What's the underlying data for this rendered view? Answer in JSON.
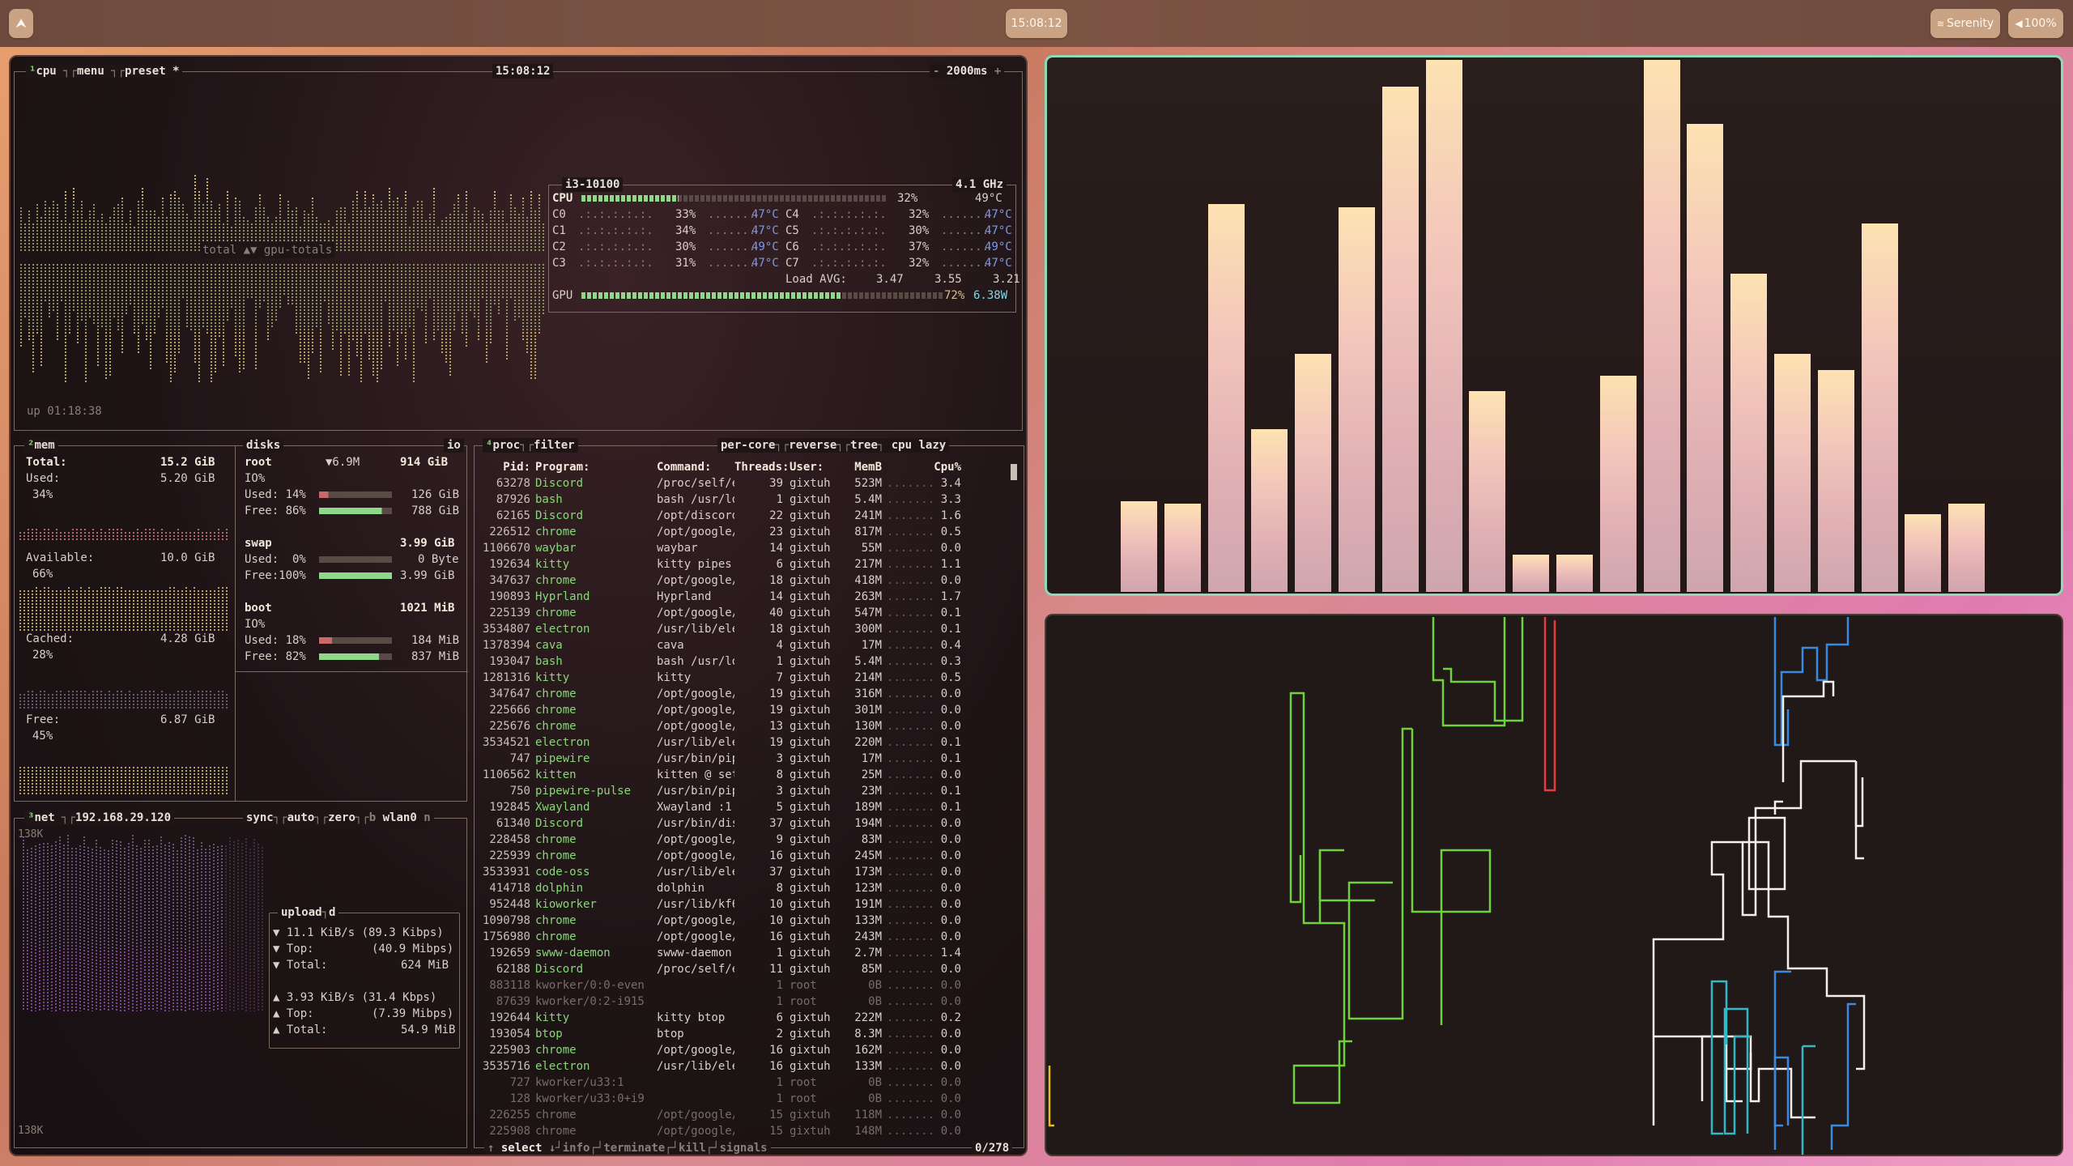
{
  "topbar": {
    "launcher_icon": "arch-icon",
    "clock": "15:08:12",
    "wifi": "Serenity",
    "volume": "100%"
  },
  "btop": {
    "cpu_box": {
      "title_cpu": "cpu",
      "title_menu": "menu",
      "title_preset": "preset *",
      "time": "15:08:12",
      "interval": "2000ms",
      "graph_label": "total ▲▼ gpu-totals",
      "uptime": "up 01:18:38"
    },
    "cpu_info": {
      "model": "i3-10100",
      "freq": "4.1 GHz",
      "total_label": "CPU",
      "total_pct": "32%",
      "total_temp": "49°C",
      "cores": [
        {
          "name": "C0",
          "pct": "33%",
          "temp": "47°C"
        },
        {
          "name": "C1",
          "pct": "34%",
          "temp": "47°C"
        },
        {
          "name": "C2",
          "pct": "30%",
          "temp": "49°C"
        },
        {
          "name": "C3",
          "pct": "31%",
          "temp": "47°C"
        },
        {
          "name": "C4",
          "pct": "32%",
          "temp": "47°C"
        },
        {
          "name": "C5",
          "pct": "30%",
          "temp": "47°C"
        },
        {
          "name": "C6",
          "pct": "37%",
          "temp": "49°C"
        },
        {
          "name": "C7",
          "pct": "32%",
          "temp": "47°C"
        }
      ],
      "load_label": "Load AVG:",
      "load": [
        "3.47",
        "3.55",
        "3.21"
      ],
      "gpu_label": "GPU",
      "gpu_pct": "72%",
      "gpu_power": "6.38W"
    },
    "mem": {
      "title": "mem",
      "total_label": "Total:",
      "total": "15.2 GiB",
      "used_label": "Used:",
      "used": "5.20 GiB",
      "used_pct": "34%",
      "avail_label": "Available:",
      "avail": "10.0 GiB",
      "avail_pct": "66%",
      "cached_label": "Cached:",
      "cached": "4.28 GiB",
      "cached_pct": "28%",
      "free_label": "Free:",
      "free": "6.87 GiB",
      "free_pct": "45%"
    },
    "disks": {
      "title": "disks",
      "io_label": "io",
      "root": {
        "name": "root",
        "io_rate": "▼6.9M",
        "size": "914 GiB",
        "io": "IO%",
        "used_label": "Used: 14%",
        "used": "126 GiB",
        "free_label": "Free: 86%",
        "free": "788 GiB"
      },
      "swap": {
        "name": "swap",
        "size": "3.99 GiB",
        "used_label": "Used:  0%",
        "used": "0 Byte",
        "free_label": "Free:100%",
        "free": "3.99 GiB"
      },
      "boot": {
        "name": "boot",
        "size": "1021 MiB",
        "io": "IO%",
        "used_label": "Used: 18%",
        "used": "184 MiB",
        "free_label": "Free: 82%",
        "free": "837 MiB"
      }
    },
    "net": {
      "title": "net",
      "ip": "192.168.29.120",
      "sync": "sync",
      "auto": "auto",
      "zero": "zero",
      "b": "b",
      "iface": "wlan0",
      "n": "n",
      "scale_top": "138K",
      "scale_bottom": "138K",
      "box_title": "upload",
      "box_title_suffix": "d",
      "down_rate": "11.1 KiB/s (89.3 Kibps)",
      "down_top_label": "Top:",
      "down_top": "(40.9 Mibps)",
      "down_total_label": "Total:",
      "down_total": "624 MiB",
      "up_rate": "3.93 KiB/s (31.4 Kbps)",
      "up_top_label": "Top:",
      "up_top": "(7.39 Mibps)",
      "up_total_label": "Total:",
      "up_total": "54.9 MiB"
    },
    "proc": {
      "title": "proc",
      "filter": "filter",
      "per_core": "per-core",
      "reverse": "reverse",
      "tree": "tree",
      "sort": "cpu lazy",
      "headers": {
        "pid": "Pid:",
        "program": "Program:",
        "command": "Command:",
        "threads": "Threads:",
        "user": "User:",
        "mem": "MemB",
        "cpu": "Cpu%"
      },
      "rows": [
        [
          "63278",
          "Discord",
          "/proc/self/ex",
          "39",
          "gixtuh",
          "523M",
          "3.4"
        ],
        [
          "87926",
          "bash",
          "bash /usr/loc",
          "1",
          "gixtuh",
          "5.4M",
          "3.3"
        ],
        [
          "62165",
          "Discord",
          "/opt/discord/",
          "22",
          "gixtuh",
          "241M",
          "1.6"
        ],
        [
          "226512",
          "chrome",
          "/opt/google/c",
          "23",
          "gixtuh",
          "817M",
          "0.5"
        ],
        [
          "1106670",
          "waybar",
          "waybar",
          "14",
          "gixtuh",
          "55M",
          "0.0"
        ],
        [
          "192634",
          "kitty",
          "kitty pipes.s",
          "6",
          "gixtuh",
          "217M",
          "1.1"
        ],
        [
          "347637",
          "chrome",
          "/opt/google/c",
          "18",
          "gixtuh",
          "418M",
          "0.0"
        ],
        [
          "190893",
          "Hyprland",
          "Hyprland",
          "14",
          "gixtuh",
          "263M",
          "1.7"
        ],
        [
          "225139",
          "chrome",
          "/opt/google/c",
          "40",
          "gixtuh",
          "547M",
          "0.1"
        ],
        [
          "3534807",
          "electron",
          "/usr/lib/elec",
          "18",
          "gixtuh",
          "300M",
          "0.1"
        ],
        [
          "1378394",
          "cava",
          "cava",
          "4",
          "gixtuh",
          "17M",
          "0.4"
        ],
        [
          "193047",
          "bash",
          "bash /usr/loc",
          "1",
          "gixtuh",
          "5.4M",
          "0.3"
        ],
        [
          "1281316",
          "kitty",
          "kitty",
          "7",
          "gixtuh",
          "214M",
          "0.5"
        ],
        [
          "347647",
          "chrome",
          "/opt/google/c",
          "19",
          "gixtuh",
          "316M",
          "0.0"
        ],
        [
          "225666",
          "chrome",
          "/opt/google/c",
          "19",
          "gixtuh",
          "301M",
          "0.0"
        ],
        [
          "225676",
          "chrome",
          "/opt/google/c",
          "13",
          "gixtuh",
          "130M",
          "0.0"
        ],
        [
          "3534521",
          "electron",
          "/usr/lib/elec",
          "19",
          "gixtuh",
          "220M",
          "0.1"
        ],
        [
          "747",
          "pipewire",
          "/usr/bin/pipe",
          "3",
          "gixtuh",
          "17M",
          "0.1"
        ],
        [
          "1106562",
          "kitten",
          "kitten @ set-",
          "8",
          "gixtuh",
          "25M",
          "0.0"
        ],
        [
          "750",
          "pipewire-pulse",
          "/usr/bin/pipe",
          "3",
          "gixtuh",
          "23M",
          "0.1"
        ],
        [
          "192845",
          "Xwayland",
          "Xwayland :1 -",
          "5",
          "gixtuh",
          "189M",
          "0.1"
        ],
        [
          "61340",
          "Discord",
          "/usr/bin/disc",
          "37",
          "gixtuh",
          "194M",
          "0.0"
        ],
        [
          "228458",
          "chrome",
          "/opt/google/c",
          "9",
          "gixtuh",
          "83M",
          "0.0"
        ],
        [
          "225939",
          "chrome",
          "/opt/google/c",
          "16",
          "gixtuh",
          "245M",
          "0.0"
        ],
        [
          "3533931",
          "code-oss",
          "/usr/lib/elec",
          "37",
          "gixtuh",
          "173M",
          "0.0"
        ],
        [
          "414718",
          "dolphin",
          "dolphin",
          "8",
          "gixtuh",
          "123M",
          "0.0"
        ],
        [
          "952448",
          "kioworker",
          "/usr/lib/kf6/",
          "10",
          "gixtuh",
          "191M",
          "0.0"
        ],
        [
          "1090798",
          "chrome",
          "/opt/google/c",
          "10",
          "gixtuh",
          "133M",
          "0.0"
        ],
        [
          "1756980",
          "chrome",
          "/opt/google/c",
          "16",
          "gixtuh",
          "243M",
          "0.0"
        ],
        [
          "192659",
          "swww-daemon",
          "swww-daemon",
          "1",
          "gixtuh",
          "2.7M",
          "1.4"
        ],
        [
          "62188",
          "Discord",
          "/proc/self/ex",
          "11",
          "gixtuh",
          "85M",
          "0.0"
        ],
        [
          "883118",
          "kworker/0:0-even",
          "",
          "1",
          "root",
          "0B",
          "0.0"
        ],
        [
          "87639",
          "kworker/0:2-i915",
          "",
          "1",
          "root",
          "0B",
          "0.0"
        ],
        [
          "192644",
          "kitty",
          "kitty btop",
          "6",
          "gixtuh",
          "222M",
          "0.2"
        ],
        [
          "193054",
          "btop",
          "btop",
          "2",
          "gixtuh",
          "8.3M",
          "0.0"
        ],
        [
          "225903",
          "chrome",
          "/opt/google/c",
          "16",
          "gixtuh",
          "162M",
          "0.0"
        ],
        [
          "3535716",
          "electron",
          "/usr/lib/elec",
          "16",
          "gixtuh",
          "133M",
          "0.0"
        ],
        [
          "727",
          "kworker/u33:1",
          "",
          "1",
          "root",
          "0B",
          "0.0"
        ],
        [
          "128",
          "kworker/u33:0+i9",
          "",
          "1",
          "root",
          "0B",
          "0.0"
        ],
        [
          "226255",
          "chrome",
          "/opt/google/c",
          "15",
          "gixtuh",
          "118M",
          "0.0"
        ],
        [
          "225908",
          "chrome",
          "/opt/google/c",
          "15",
          "gixtuh",
          "148M",
          "0.0"
        ]
      ],
      "footer_select": "select",
      "footer_info": "info",
      "footer_terminate": "terminate",
      "footer_kill": "kill",
      "footer_signals": "signals",
      "footer_count": "0/278"
    }
  },
  "cava": {
    "bar_heights": [
      0.17,
      0.165,
      0.725,
      0.305,
      0.445,
      0.72,
      0.945,
      0.995,
      0.375,
      0.07,
      0.07,
      0.405,
      0.995,
      0.875,
      0.595,
      0.445,
      0.415,
      0.69,
      0.145,
      0.165
    ]
  },
  "colors": {
    "cava_border": "#8fd8b8",
    "accent_green": "#8fd88a",
    "pipe_green": "#6fd23c",
    "pipe_red": "#e23d3a",
    "pipe_blue": "#3a8ae0",
    "pipe_white": "#f4f0ee",
    "pipe_cyan": "#33b8c8",
    "pipe_yellow": "#e0c020"
  }
}
